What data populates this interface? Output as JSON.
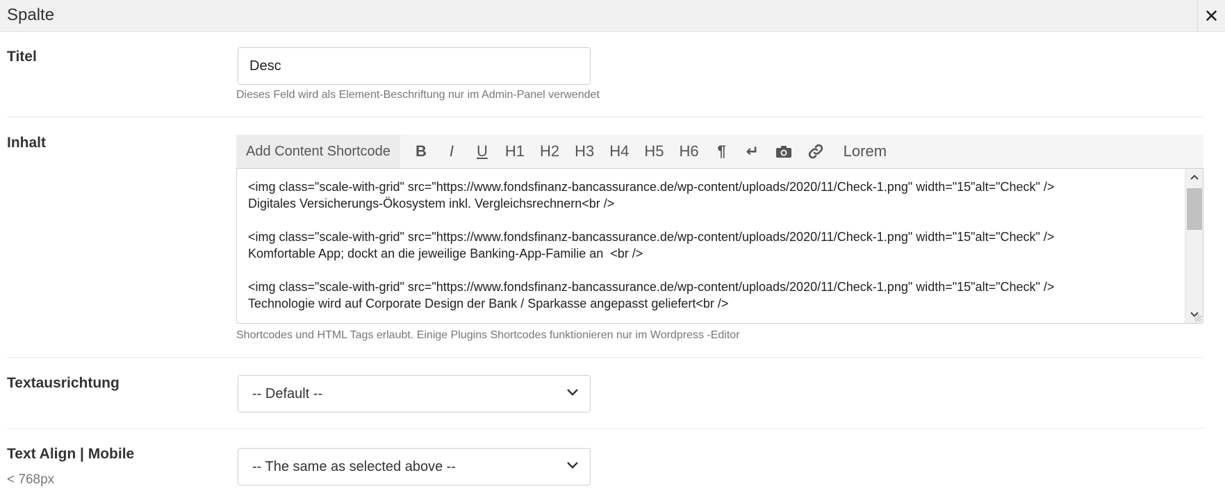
{
  "dialog": {
    "title": "Spalte",
    "close_symbol": "✕"
  },
  "fields": {
    "titel": {
      "label": "Titel",
      "value": "Desc",
      "help": "Dieses Feld wird als Element-Beschriftung nur im Admin-Panel verwendet"
    },
    "inhalt": {
      "label": "Inhalt",
      "toolbar": {
        "shortcode_label": "Add Content Shortcode",
        "buttons": [
          "B",
          "I",
          "U",
          "H1",
          "H2",
          "H3",
          "H4",
          "H5",
          "H6",
          "¶",
          "↵",
          "camera-icon",
          "link-icon",
          "Lorem"
        ]
      },
      "content": "<img class=\"scale-with-grid\" src=\"https://www.fondsfinanz-bancassurance.de/wp-content/uploads/2020/11/Check-1.png\" width=\"15\"alt=\"Check\" />\nDigitales Versicherungs-Ökosystem inkl. Vergleichsrechnern<br />\n\n<img class=\"scale-with-grid\" src=\"https://www.fondsfinanz-bancassurance.de/wp-content/uploads/2020/11/Check-1.png\" width=\"15\"alt=\"Check\" />\nKomfortable App; dockt an die jeweilige Banking-App-Familie an  <br />\n\n<img class=\"scale-with-grid\" src=\"https://www.fondsfinanz-bancassurance.de/wp-content/uploads/2020/11/Check-1.png\" width=\"15\"alt=\"Check\" />\nTechnologie wird auf Corporate Design der Bank / Sparkasse angepasst geliefert<br />",
      "help": "Shortcodes und HTML Tags erlaubt. Einige Plugins Shortcodes funktionieren nur im Wordpress -Editor"
    },
    "textausrichtung": {
      "label": "Textausrichtung",
      "selected": "-- Default --"
    },
    "text_align_mobile": {
      "label": "Text Align | Mobile",
      "sublabel": "< 768px",
      "selected": "-- The same as selected above --"
    }
  }
}
